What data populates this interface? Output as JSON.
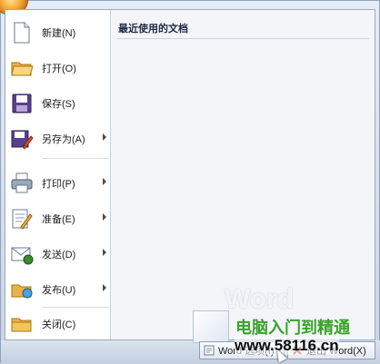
{
  "menu": {
    "items": [
      {
        "label": "新建(N)",
        "icon": "new-document-icon"
      },
      {
        "label": "打开(O)",
        "icon": "open-folder-icon"
      },
      {
        "label": "保存(S)",
        "icon": "save-disk-icon"
      },
      {
        "label": "另存为(A)",
        "icon": "save-as-icon",
        "submenu": true
      },
      {
        "label": "打印(P)",
        "icon": "printer-icon",
        "submenu": true
      },
      {
        "label": "准备(E)",
        "icon": "prepare-icon",
        "submenu": true
      },
      {
        "label": "发送(D)",
        "icon": "send-mail-icon",
        "submenu": true
      },
      {
        "label": "发布(U)",
        "icon": "publish-icon",
        "submenu": true
      },
      {
        "label": "关闭(C)",
        "icon": "close-folder-icon"
      }
    ]
  },
  "recent": {
    "title": "最近使用的文档"
  },
  "footer": {
    "options_label": "Word 选项(I)",
    "exit_label": "退出 Word(X)"
  },
  "watermark": {
    "brand": "Word",
    "site_name": "电脑入门到精通",
    "url": "www.58116.cn"
  },
  "colors": {
    "office_button": "#f2a93a",
    "menu_border": "#9aaac2",
    "watermark_green": "#3aa22a"
  }
}
